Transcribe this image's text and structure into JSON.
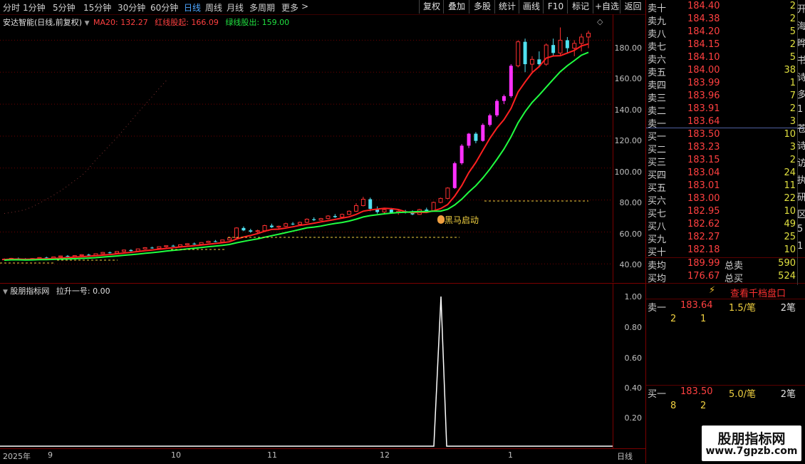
{
  "toolbar": {
    "periods": [
      "分时",
      "1分钟",
      "5分钟",
      "15分钟",
      "30分钟",
      "60分钟",
      "日线",
      "周线",
      "月线",
      "多周期",
      "更多"
    ],
    "active_period": "日线",
    "buttons": [
      "复权",
      "叠加",
      "多股",
      "统计",
      "画线",
      "F10",
      "标记",
      "+自选",
      "返回"
    ]
  },
  "main_title": {
    "stock": "安达智能(日线,前复权)",
    "ma20_label": "MA20: 132.27",
    "red_label": "红线股起: 166.09",
    "green_label": "绿线股出: 159.00"
  },
  "annotation": "黑马启动",
  "main_axis_ticks": [
    "180.00",
    "160.00",
    "140.00",
    "120.00",
    "100.00",
    "80.00",
    "60.00",
    "40.00"
  ],
  "sub_title": {
    "name": "股朋指标网",
    "indicator": "拉升一号: 0.00"
  },
  "sub_axis_ticks": [
    "1.00",
    "0.80",
    "0.60",
    "0.40",
    "0.20"
  ],
  "time_axis": {
    "labels": [
      "2025年",
      "9",
      "10",
      "11",
      "12",
      "1"
    ],
    "period": "日线"
  },
  "order_book": {
    "asks": [
      {
        "label": "卖十",
        "price": "184.40",
        "vol": "2"
      },
      {
        "label": "卖九",
        "price": "184.38",
        "vol": "2"
      },
      {
        "label": "卖八",
        "price": "184.20",
        "vol": "5"
      },
      {
        "label": "卖七",
        "price": "184.15",
        "vol": "2"
      },
      {
        "label": "卖六",
        "price": "184.10",
        "vol": "5"
      },
      {
        "label": "卖五",
        "price": "184.00",
        "vol": "38"
      },
      {
        "label": "卖四",
        "price": "183.99",
        "vol": "1"
      },
      {
        "label": "卖三",
        "price": "183.96",
        "vol": "7"
      },
      {
        "label": "卖二",
        "price": "183.91",
        "vol": "2"
      },
      {
        "label": "卖一",
        "price": "183.64",
        "vol": "3"
      }
    ],
    "bids": [
      {
        "label": "买一",
        "price": "183.50",
        "vol": "10"
      },
      {
        "label": "买二",
        "price": "183.23",
        "vol": "3"
      },
      {
        "label": "买三",
        "price": "183.15",
        "vol": "2"
      },
      {
        "label": "买四",
        "price": "183.04",
        "vol": "24"
      },
      {
        "label": "买五",
        "price": "183.01",
        "vol": "11"
      },
      {
        "label": "买六",
        "price": "183.00",
        "vol": "22"
      },
      {
        "label": "买七",
        "price": "182.95",
        "vol": "10"
      },
      {
        "label": "买八",
        "price": "182.62",
        "vol": "49"
      },
      {
        "label": "买九",
        "price": "182.27",
        "vol": "25"
      },
      {
        "label": "买十",
        "price": "182.18",
        "vol": "10"
      }
    ],
    "avg_sell_label": "卖均",
    "avg_sell": "189.99",
    "total_sell_label": "总卖",
    "total_sell": "590",
    "avg_buy_label": "买均",
    "avg_buy": "176.67",
    "total_buy_label": "总买",
    "total_buy": "524",
    "view_depth": "查看千档盘口",
    "sell1_label": "卖一",
    "sell1_price": "183.64",
    "sell1_amt": "1.5/笔",
    "sell1_count": "2笔",
    "sell1_q1": "2",
    "sell1_q2": "1",
    "buy1_label": "买一",
    "buy1_price": "183.50",
    "buy1_amt": "5.0/笔",
    "buy1_count": "2笔",
    "buy1_q1": "8",
    "buy1_q2": "2",
    "side_chars": [
      "开",
      "海",
      "晔",
      "书",
      "诗",
      "多",
      "1",
      "苍",
      "诗",
      "访",
      "执",
      "研",
      "区",
      "5",
      "1"
    ]
  },
  "watermark": {
    "line1": "股朋指标网",
    "line2": "www.7gpzb.com"
  },
  "colors": {
    "up": "#ff3030",
    "down": "#50e0f0",
    "magenta": "#ff30ff",
    "red_line": "#ff2020",
    "green_line": "#20ff40"
  },
  "chart_data": {
    "type": "candlestick",
    "candles": [
      [
        43,
        43.5,
        42.5,
        43
      ],
      [
        43,
        43.8,
        42.8,
        43.5
      ],
      [
        43.5,
        44,
        43,
        43.2
      ],
      [
        43.2,
        43.6,
        42.6,
        42.9
      ],
      [
        42.9,
        43.6,
        42.7,
        43.4
      ],
      [
        43.4,
        44.2,
        43.1,
        44
      ],
      [
        44,
        44.5,
        43.5,
        43.7
      ],
      [
        43.7,
        44.6,
        43.5,
        44.4
      ],
      [
        44.4,
        45.3,
        44.1,
        45
      ],
      [
        45,
        45.5,
        44.4,
        44.6
      ],
      [
        44.6,
        45.4,
        44.2,
        45.2
      ],
      [
        45.2,
        46,
        45,
        45.8
      ],
      [
        45.8,
        46.3,
        45.2,
        45.4
      ],
      [
        45.4,
        46.6,
        45.1,
        46.4
      ],
      [
        46.4,
        47.5,
        46.1,
        47.2
      ],
      [
        47.2,
        47.8,
        46.5,
        46.8
      ],
      [
        46.8,
        48,
        46.6,
        47.8
      ],
      [
        47.8,
        49,
        47.4,
        48.7
      ],
      [
        48.7,
        49.2,
        47.8,
        48.1
      ],
      [
        48.1,
        49.6,
        47.9,
        49.4
      ],
      [
        49.4,
        50.5,
        49,
        50.2
      ],
      [
        50.2,
        50.8,
        49.5,
        49.8
      ],
      [
        49.8,
        51,
        49.5,
        50.8
      ],
      [
        50.8,
        51.6,
        50.2,
        51.4
      ],
      [
        51.4,
        52,
        50.8,
        51
      ],
      [
        51,
        52.2,
        50.7,
        52
      ],
      [
        52,
        53,
        51.6,
        52.7
      ],
      [
        52.7,
        53.4,
        52,
        52.3
      ],
      [
        52.3,
        53.6,
        52,
        53.4
      ],
      [
        53.4,
        54.5,
        53.1,
        54.2
      ],
      [
        54.2,
        55,
        53.6,
        53.8
      ],
      [
        53.8,
        55.2,
        53.5,
        55
      ],
      [
        55,
        56.6,
        54.7,
        56.3
      ],
      [
        56.3,
        63,
        56,
        62.5
      ],
      [
        62.5,
        63.5,
        60.5,
        61
      ],
      [
        61,
        62,
        59.5,
        60.2
      ],
      [
        60.2,
        61.5,
        59,
        60.8
      ],
      [
        60.8,
        64.5,
        60.3,
        64
      ],
      [
        64,
        65.2,
        62.5,
        63
      ],
      [
        63,
        64,
        62,
        63.6
      ],
      [
        63.6,
        65.8,
        63.2,
        65.2
      ],
      [
        65.2,
        66.2,
        64.2,
        64.8
      ],
      [
        64.8,
        66.5,
        64.4,
        66
      ],
      [
        66,
        68.5,
        65.6,
        68
      ],
      [
        68,
        69.2,
        66.8,
        67.4
      ],
      [
        67.4,
        68.8,
        67,
        68.4
      ],
      [
        68.4,
        70.5,
        68,
        70
      ],
      [
        70,
        71.2,
        68.8,
        69.3
      ],
      [
        69.3,
        71.5,
        69,
        71
      ],
      [
        71,
        73.5,
        70.6,
        73
      ],
      [
        73,
        78,
        72.5,
        76.5
      ],
      [
        76.5,
        82,
        76,
        80.5
      ],
      [
        80.5,
        81.5,
        73,
        74.5
      ],
      [
        74.5,
        76,
        71.5,
        72.5
      ],
      [
        72.5,
        74.5,
        71.8,
        74
      ],
      [
        74,
        75,
        71.5,
        72
      ],
      [
        72,
        73.8,
        70.8,
        73
      ],
      [
        73,
        73.8,
        71.6,
        72.2
      ],
      [
        72.2,
        73.5,
        70.5,
        71
      ],
      [
        71,
        74.5,
        70.7,
        74
      ],
      [
        74,
        75.2,
        72.5,
        73.2
      ],
      [
        73.2,
        79,
        73,
        78.5
      ],
      [
        78.5,
        81.5,
        78,
        81
      ],
      [
        81,
        88,
        80.5,
        87.5
      ],
      [
        87.5,
        104,
        87,
        103
      ],
      [
        103,
        115,
        102,
        114
      ],
      [
        114,
        122,
        112.5,
        121.5
      ],
      [
        121.5,
        122.5,
        115.5,
        117
      ],
      [
        117,
        128,
        116.5,
        127
      ],
      [
        127,
        134,
        126,
        133
      ],
      [
        133,
        143,
        132,
        142
      ],
      [
        142,
        146,
        140,
        145
      ],
      [
        145,
        165,
        144,
        164
      ],
      [
        164,
        180,
        163,
        179
      ],
      [
        179,
        181,
        160,
        165
      ],
      [
        165,
        170,
        159,
        168
      ],
      [
        168,
        173,
        163,
        165
      ],
      [
        165,
        178,
        164,
        177
      ],
      [
        177,
        181,
        170,
        172
      ],
      [
        172,
        188,
        170,
        180
      ],
      [
        180,
        182,
        172,
        175
      ],
      [
        175,
        180,
        170,
        178
      ],
      [
        178,
        184,
        173,
        182
      ],
      [
        182,
        186,
        175,
        184.4
      ]
    ],
    "ylim": [
      33,
      190
    ]
  }
}
